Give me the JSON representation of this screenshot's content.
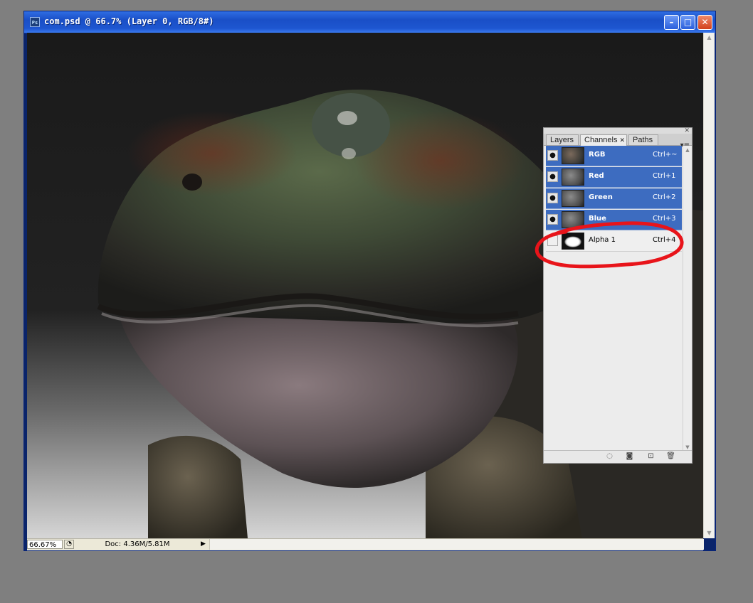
{
  "window": {
    "title": "com.psd @ 66.7% (Layer 0, RGB/8#)",
    "app_icon": "Ps",
    "minimize_glyph": "–",
    "maximize_glyph": "□",
    "close_glyph": "✕"
  },
  "status": {
    "zoom": "66.67%",
    "doc": "Doc: 4.36M/5.81M",
    "arrow": "▶"
  },
  "panel": {
    "tabs": [
      {
        "label": "Layers"
      },
      {
        "label": "Channels",
        "close": "✕"
      },
      {
        "label": "Paths"
      }
    ],
    "close_glyph": "✕",
    "menu_glyph": "▾≡",
    "channels": [
      {
        "name": "RGB",
        "shortcut": "Ctrl+~",
        "visible": true,
        "selected": true
      },
      {
        "name": "Red",
        "shortcut": "Ctrl+1",
        "visible": true,
        "selected": true
      },
      {
        "name": "Green",
        "shortcut": "Ctrl+2",
        "visible": true,
        "selected": true
      },
      {
        "name": "Blue",
        "shortcut": "Ctrl+3",
        "visible": true,
        "selected": true
      },
      {
        "name": "Alpha 1",
        "shortcut": "Ctrl+4",
        "visible": false,
        "selected": false
      }
    ],
    "eye_glyph": "●",
    "bottom_buttons": [
      "◌",
      "◙",
      "⊡",
      "🗑"
    ]
  },
  "annotation_color": "#e8141a",
  "selection_color": "#3d6cc0"
}
